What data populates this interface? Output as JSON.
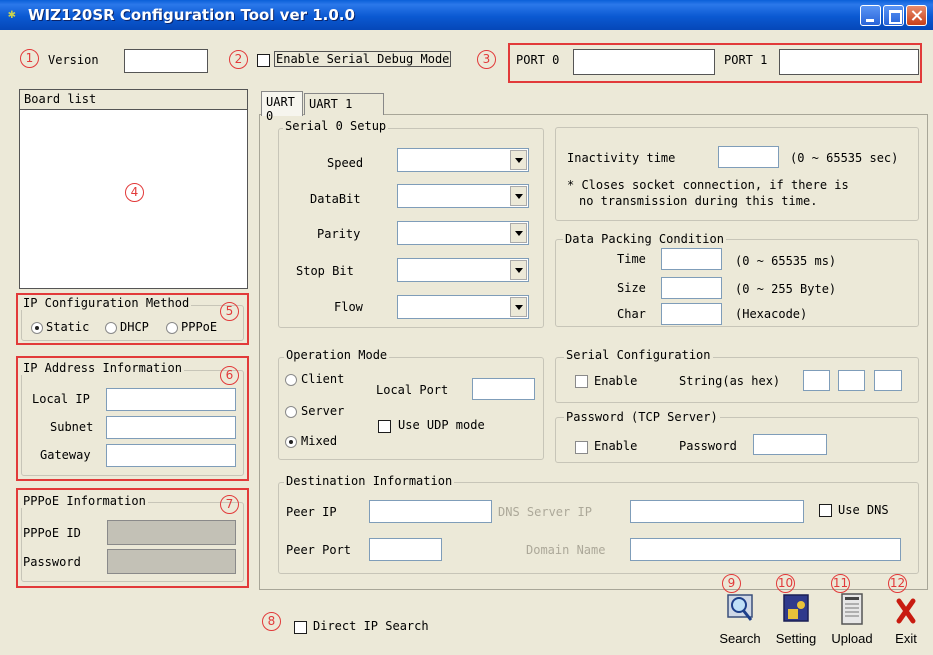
{
  "window": {
    "title": "WIZ120SR Configuration Tool ver 1.0.0"
  },
  "callouts": [
    "1",
    "2",
    "3",
    "4",
    "5",
    "6",
    "7",
    "8",
    "9",
    "10",
    "11",
    "12"
  ],
  "header": {
    "version_label": "Version",
    "version_value": "",
    "debug_checkbox_label": "Enable Serial Debug Mode",
    "port0_label": "PORT 0",
    "port0_value": "",
    "port1_label": "PORT 1",
    "port1_value": ""
  },
  "board_list": {
    "header": "Board list",
    "items": []
  },
  "ip_config": {
    "title": "IP Configuration Method",
    "options": [
      "Static",
      "DHCP",
      "PPPoE"
    ],
    "selected": "Static"
  },
  "ip_address": {
    "title": "IP Address Information",
    "local_ip_label": "Local IP",
    "subnet_label": "Subnet",
    "gateway_label": "Gateway"
  },
  "pppoe": {
    "title": "PPPoE Information",
    "id_label": "PPPoE ID",
    "password_label": "Password"
  },
  "tabs": [
    "UART 0",
    "UART 1"
  ],
  "serial_setup": {
    "title": "Serial 0 Setup",
    "fields": [
      "Speed",
      "DataBit",
      "Parity",
      "Stop Bit",
      "Flow"
    ]
  },
  "inactivity": {
    "label": "Inactivity time",
    "range": "(0 ~ 65535 sec)",
    "note_line1": "* Closes socket connection, if there is",
    "note_line2": "no transmission during this time."
  },
  "data_packing": {
    "title": "Data Packing Condition",
    "time_label": "Time",
    "time_range": "(0 ~ 65535 ms)",
    "size_label": "Size",
    "size_range": "(0 ~ 255 Byte)",
    "char_label": "Char",
    "char_range": "(Hexacode)"
  },
  "operation_mode": {
    "title": "Operation Mode",
    "options": [
      "Client",
      "Server",
      "Mixed"
    ],
    "selected": "Mixed",
    "local_port_label": "Local Port",
    "udp_label": "Use UDP mode"
  },
  "serial_config": {
    "title": "Serial Configuration",
    "enable_label": "Enable",
    "string_label": "String(as hex)"
  },
  "password_tcp": {
    "title": "Password (TCP Server)",
    "enable_label": "Enable",
    "password_label": "Password"
  },
  "destination": {
    "title": "Destination Information",
    "peer_ip_label": "Peer IP",
    "dns_server_label": "DNS Server IP",
    "use_dns_label": "Use DNS",
    "peer_port_label": "Peer Port",
    "domain_label": "Domain Name"
  },
  "footer": {
    "direct_ip_label": "Direct IP Search"
  },
  "toolbar": {
    "search": "Search",
    "setting": "Setting",
    "upload": "Upload",
    "exit": "Exit"
  },
  "colors": {
    "callout": "#e23a3a",
    "titlebar": "#0b59d2",
    "window_bg": "#ece9d8"
  }
}
